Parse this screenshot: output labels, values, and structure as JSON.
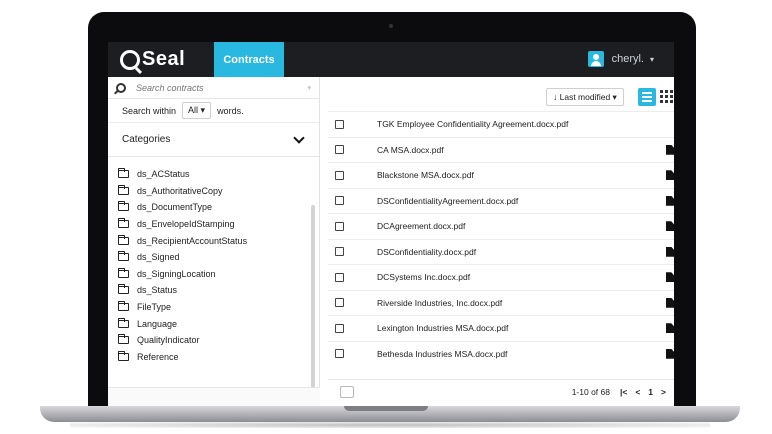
{
  "app": {
    "logo_text": "Seal",
    "nav_tab": "Contracts",
    "user_name": "cheryl."
  },
  "sidebar": {
    "search_placeholder": "Search contracts",
    "within_prefix": "Search within",
    "within_value": "All ▾",
    "within_suffix": "words.",
    "categories_label": "Categories",
    "categories": [
      "ds_ACStatus",
      "ds_AuthoritativeCopy",
      "ds_DocumentType",
      "ds_EnvelopeIdStamping",
      "ds_RecipientAccountStatus",
      "ds_Signed",
      "ds_SigningLocation",
      "ds_Status",
      "FileType",
      "Language",
      "QualityIndicator",
      "Reference"
    ]
  },
  "main": {
    "sort_label": "↓ Last modified ▾",
    "files": [
      "TGK Employee Confidentiality Agreement.docx.pdf",
      "CA MSA.docx.pdf",
      "Blackstone MSA.docx.pdf",
      "DSConfidentialityAgreement.docx.pdf",
      "DCAgreement.docx.pdf",
      "DSConfidentiality.docx.pdf",
      "DCSystems Inc.docx.pdf",
      "Riverside Industries, Inc.docx.pdf",
      "Lexington Industries MSA.docx.pdf",
      "Bethesda Industries MSA.docx.pdf"
    ],
    "pagination": "1-10 of 68",
    "page_number": "1"
  },
  "colors": {
    "accent": "#28b8e0",
    "topbar": "#1d1e22"
  }
}
